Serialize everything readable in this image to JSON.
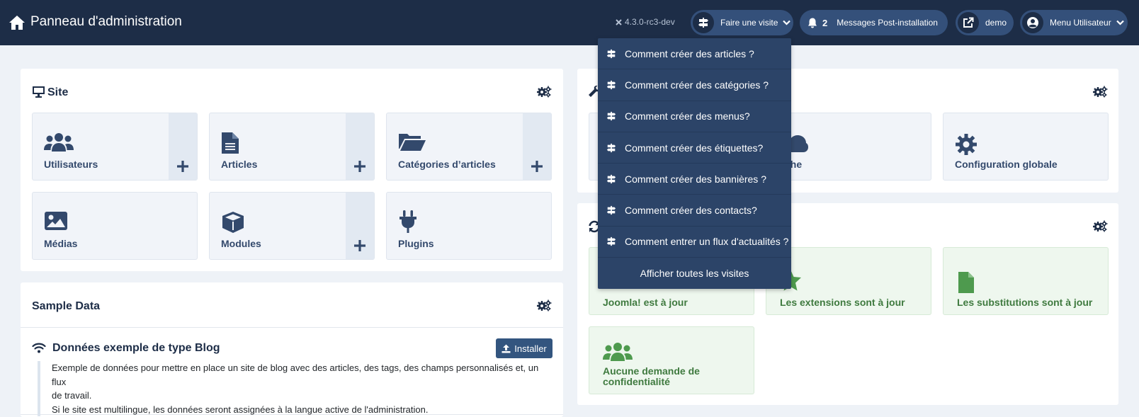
{
  "header": {
    "title": "Panneau d'administration",
    "version": "4.3.0-rc3-dev",
    "tour_label": "Faire une visite",
    "messages_count": "2",
    "messages_label": "Messages Post-installation",
    "site_label": "demo",
    "user_menu_label": "Menu Utilisateur"
  },
  "tour_menu": {
    "items": [
      "Comment créer des articles ?",
      "Comment créer des catégories ?",
      "Comment créer des menus?",
      "Comment créer des étiquettes?",
      "Comment créer des bannières ?",
      "Comment créer des contacts?",
      "Comment entrer un flux d'actualités ?"
    ],
    "all_label": "Afficher toutes les visites"
  },
  "site_card": {
    "title": "Site",
    "tiles": [
      {
        "label": "Utilisateurs",
        "icon": "users-icon",
        "has_add": true
      },
      {
        "label": "Articles",
        "icon": "file-icon",
        "has_add": true
      },
      {
        "label": "Catégories d’articles",
        "icon": "folder-open-icon",
        "has_add": true
      },
      {
        "label": "Médias",
        "icon": "image-icon",
        "has_add": false
      },
      {
        "label": "Modules",
        "icon": "cube-icon",
        "has_add": true
      },
      {
        "label": "Plugins",
        "icon": "plug-icon",
        "has_add": false
      }
    ]
  },
  "system_card": {
    "tiles": [
      {
        "label": "che",
        "icon": "cloud-icon"
      },
      {
        "label": "Configuration globale",
        "icon": "gear-icon"
      }
    ]
  },
  "update_card": {
    "tiles": [
      {
        "label": "Joomla! est à jour",
        "icon": "joomla-icon"
      },
      {
        "label": "Les extensions sont à jour",
        "icon": "star-icon"
      },
      {
        "label": "Les substitutions sont à jour",
        "icon": "file-icon"
      },
      {
        "label_line1": "Aucune demande de",
        "label_line2": "confidentialité",
        "icon": "users-icon"
      }
    ]
  },
  "sample_data": {
    "title": "Sample Data",
    "blog_title": "Données exemple de type Blog",
    "install_label": "Installer",
    "desc_line1": "Exemple de données pour mettre en place un site de blog avec des articles, des tags, des champs personnalisés et, un flux",
    "desc_line2": "de travail.",
    "desc_line3": "Si le site est multilingue, les données seront assignées à la langue active de l'administration."
  },
  "colors": {
    "header_bg": "#1d2d47",
    "accent": "#34507a",
    "dropdown_bg": "#2c4468",
    "tile_text": "#33496c",
    "success": "#3f7a3f"
  }
}
